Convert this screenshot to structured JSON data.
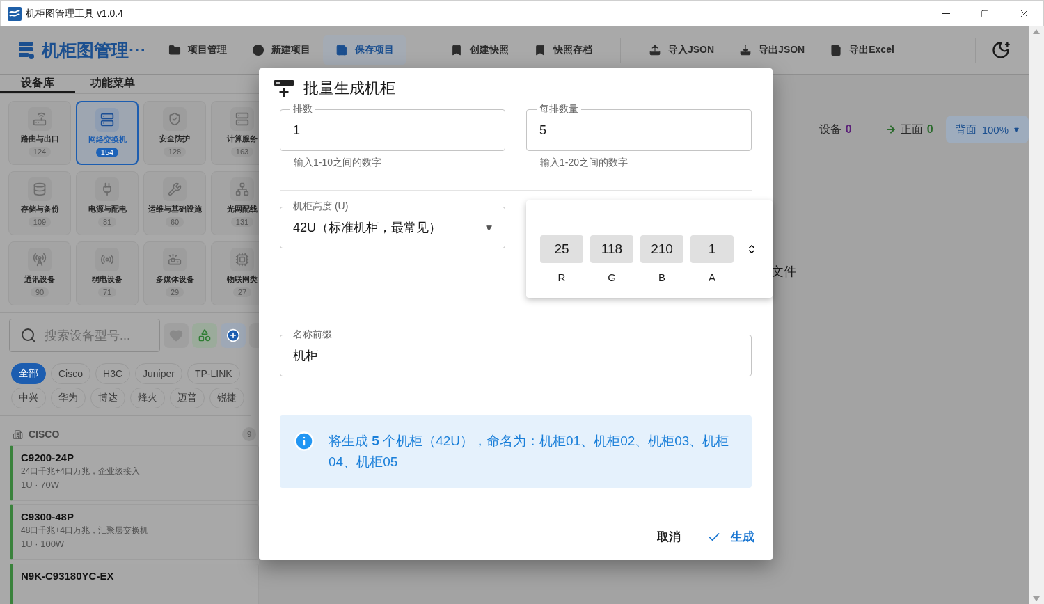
{
  "window": {
    "title": "机柜图管理工具 v1.0.4"
  },
  "app_bar": {
    "title": "机柜图管理···",
    "action_groups": [
      [
        {
          "label": "项目管理",
          "selected": false
        },
        {
          "label": "新建项目",
          "selected": false
        },
        {
          "label": "保存项目",
          "selected": true
        }
      ],
      [
        {
          "label": "创建快照",
          "selected": false
        },
        {
          "label": "快照存档",
          "selected": false
        }
      ],
      [
        {
          "label": "导入JSON",
          "selected": false
        },
        {
          "label": "导出JSON",
          "selected": false
        },
        {
          "label": "导出Excel",
          "selected": false
        }
      ]
    ]
  },
  "sidebar": {
    "tabs": [
      {
        "label": "设备库",
        "selected": true
      },
      {
        "label": "功能菜单",
        "selected": false
      }
    ],
    "categories": [
      {
        "name": "路由与出口",
        "count": "124",
        "selected": false
      },
      {
        "name": "网络交换机",
        "count": "154",
        "selected": true
      },
      {
        "name": "安全防护",
        "count": "128",
        "selected": false
      },
      {
        "name": "计算服务",
        "count": "163",
        "selected": false
      },
      {
        "name": "存储与备份",
        "count": "109",
        "selected": false
      },
      {
        "name": "电源与配电",
        "count": "81",
        "selected": false
      },
      {
        "name": "运维与基础设施",
        "count": "60",
        "selected": false
      },
      {
        "name": "光网配线",
        "count": "131",
        "selected": false
      },
      {
        "name": "通讯设备",
        "count": "90",
        "selected": false
      },
      {
        "name": "弱电设备",
        "count": "71",
        "selected": false
      },
      {
        "name": "多媒体设备",
        "count": "29",
        "selected": false
      },
      {
        "name": "物联网类",
        "count": "27",
        "selected": false
      }
    ],
    "search": {
      "placeholder": "搜索设备型号..."
    },
    "brands": [
      {
        "label": "全部",
        "selected": true
      },
      {
        "label": "Cisco",
        "selected": false
      },
      {
        "label": "H3C",
        "selected": false
      },
      {
        "label": "Juniper",
        "selected": false
      },
      {
        "label": "TP-LINK",
        "selected": false
      },
      {
        "label": "中兴",
        "selected": false
      },
      {
        "label": "华为",
        "selected": false
      },
      {
        "label": "博达",
        "selected": false
      },
      {
        "label": "烽火",
        "selected": false
      },
      {
        "label": "迈普",
        "selected": false
      },
      {
        "label": "锐捷",
        "selected": false
      }
    ],
    "groups": [
      {
        "name": "CISCO",
        "count": "9",
        "devices": [
          {
            "model": "C9200-24P",
            "description": "24口千兆+4口万兆，企业级接入",
            "specs": "1U · 70W"
          },
          {
            "model": "C9300-48P",
            "description": "48口千兆+4口万兆，汇聚层交换机",
            "specs": "1U · 100W"
          },
          {
            "model": "N9K-C93180YC-EX"
          }
        ]
      }
    ]
  },
  "canvas": {
    "stats": [
      {
        "label": "设备",
        "value": "0",
        "color": "#5a1f78"
      },
      {
        "label": "正面",
        "value": "0",
        "color": "#2a6a2c"
      }
    ],
    "view_select": {
      "label": "背面",
      "value": "100%"
    },
    "hint": "文件"
  },
  "dialog": {
    "title": "批量生成机柜",
    "rows_field": {
      "label": "排数",
      "value": "1",
      "helper": "输入1-10之间的数字"
    },
    "per_row_field": {
      "label": "每排数量",
      "value": "5",
      "helper": "输入1-20之间的数字"
    },
    "height_select": {
      "label": "机柜高度 (U)",
      "value": "42U（标准机柜，最常见）"
    },
    "color_picker": {
      "channels": [
        {
          "label": "R",
          "value": "25"
        },
        {
          "label": "G",
          "value": "118"
        },
        {
          "label": "B",
          "value": "210"
        },
        {
          "label": "A",
          "value": "1"
        }
      ]
    },
    "prefix_field": {
      "label": "名称前缀",
      "value": "机柜"
    },
    "info": "将生成 **5** 个机柜（42U），命名为：机柜01、机柜02、机柜03、机柜04、机柜05",
    "buttons": [
      {
        "label": "取消",
        "kind": "text"
      },
      {
        "label": "生成",
        "kind": "confirm"
      }
    ]
  }
}
